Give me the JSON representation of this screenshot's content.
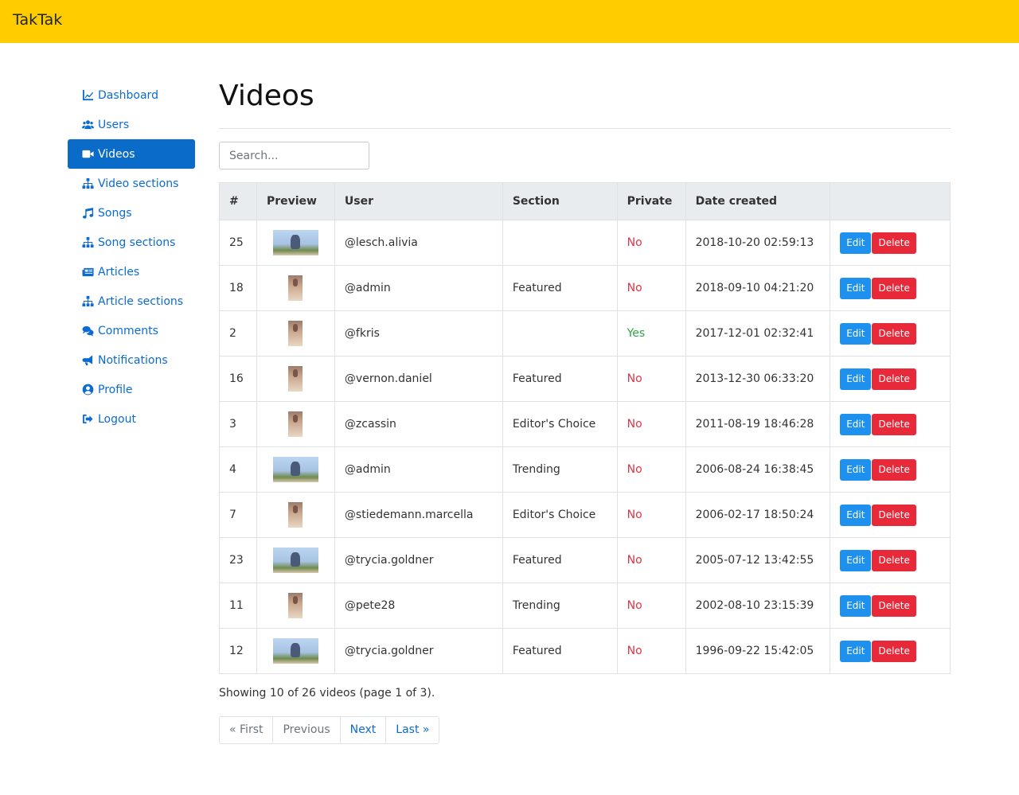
{
  "app": {
    "brand": "TakTak"
  },
  "sidebar": {
    "items": [
      {
        "label": "Dashboard",
        "icon": "chart-line-icon"
      },
      {
        "label": "Users",
        "icon": "users-icon"
      },
      {
        "label": "Videos",
        "icon": "video-icon",
        "active": true
      },
      {
        "label": "Video sections",
        "icon": "sitemap-icon"
      },
      {
        "label": "Songs",
        "icon": "music-icon"
      },
      {
        "label": "Song sections",
        "icon": "sitemap-icon"
      },
      {
        "label": "Articles",
        "icon": "newspaper-icon"
      },
      {
        "label": "Article sections",
        "icon": "sitemap-icon"
      },
      {
        "label": "Comments",
        "icon": "comments-icon"
      },
      {
        "label": "Notifications",
        "icon": "bullhorn-icon"
      },
      {
        "label": "Profile",
        "icon": "user-circle-icon"
      },
      {
        "label": "Logout",
        "icon": "sign-out-icon"
      }
    ]
  },
  "main": {
    "title": "Videos",
    "search_placeholder": "Search...",
    "table": {
      "headers": [
        "#",
        "Preview",
        "User",
        "Section",
        "Private",
        "Date created",
        ""
      ],
      "rows": [
        {
          "id": "25",
          "preview": "wide",
          "user": "@lesch.alivia",
          "section": "",
          "private": "No",
          "date": "2018-10-20 02:59:13"
        },
        {
          "id": "18",
          "preview": "tall",
          "user": "@admin",
          "section": "Featured",
          "private": "No",
          "date": "2018-09-10 04:21:20"
        },
        {
          "id": "2",
          "preview": "tall",
          "user": "@fkris",
          "section": "",
          "private": "Yes",
          "date": "2017-12-01 02:32:41"
        },
        {
          "id": "16",
          "preview": "tall",
          "user": "@vernon.daniel",
          "section": "Featured",
          "private": "No",
          "date": "2013-12-30 06:33:20"
        },
        {
          "id": "3",
          "preview": "tall",
          "user": "@zcassin",
          "section": "Editor's Choice",
          "private": "No",
          "date": "2011-08-19 18:46:28"
        },
        {
          "id": "4",
          "preview": "wide",
          "user": "@admin",
          "section": "Trending",
          "private": "No",
          "date": "2006-08-24 16:38:45"
        },
        {
          "id": "7",
          "preview": "tall",
          "user": "@stiedemann.marcella",
          "section": "Editor's Choice",
          "private": "No",
          "date": "2006-02-17 18:50:24"
        },
        {
          "id": "23",
          "preview": "wide",
          "user": "@trycia.goldner",
          "section": "Featured",
          "private": "No",
          "date": "2005-07-12 13:42:55"
        },
        {
          "id": "11",
          "preview": "tall",
          "user": "@pete28",
          "section": "Trending",
          "private": "No",
          "date": "2002-08-10 23:15:39"
        },
        {
          "id": "12",
          "preview": "wide",
          "user": "@trycia.goldner",
          "section": "Featured",
          "private": "No",
          "date": "1996-09-22 15:42:05"
        }
      ],
      "edit_label": "Edit",
      "delete_label": "Delete"
    },
    "summary": "Showing 10 of 26 videos (page 1 of 3).",
    "pagination": [
      {
        "label": "« First",
        "enabled": false
      },
      {
        "label": "Previous",
        "enabled": false
      },
      {
        "label": "Next",
        "enabled": true
      },
      {
        "label": "Last »",
        "enabled": true
      }
    ]
  },
  "colors": {
    "navbar": "#ffcc00",
    "link": "#0b6bd3",
    "active_nav": "#0a6bc9",
    "edit_button": "#1e90ee",
    "delete_button": "#e8293a",
    "private_no": "#dc3545",
    "private_yes": "#28a745"
  }
}
